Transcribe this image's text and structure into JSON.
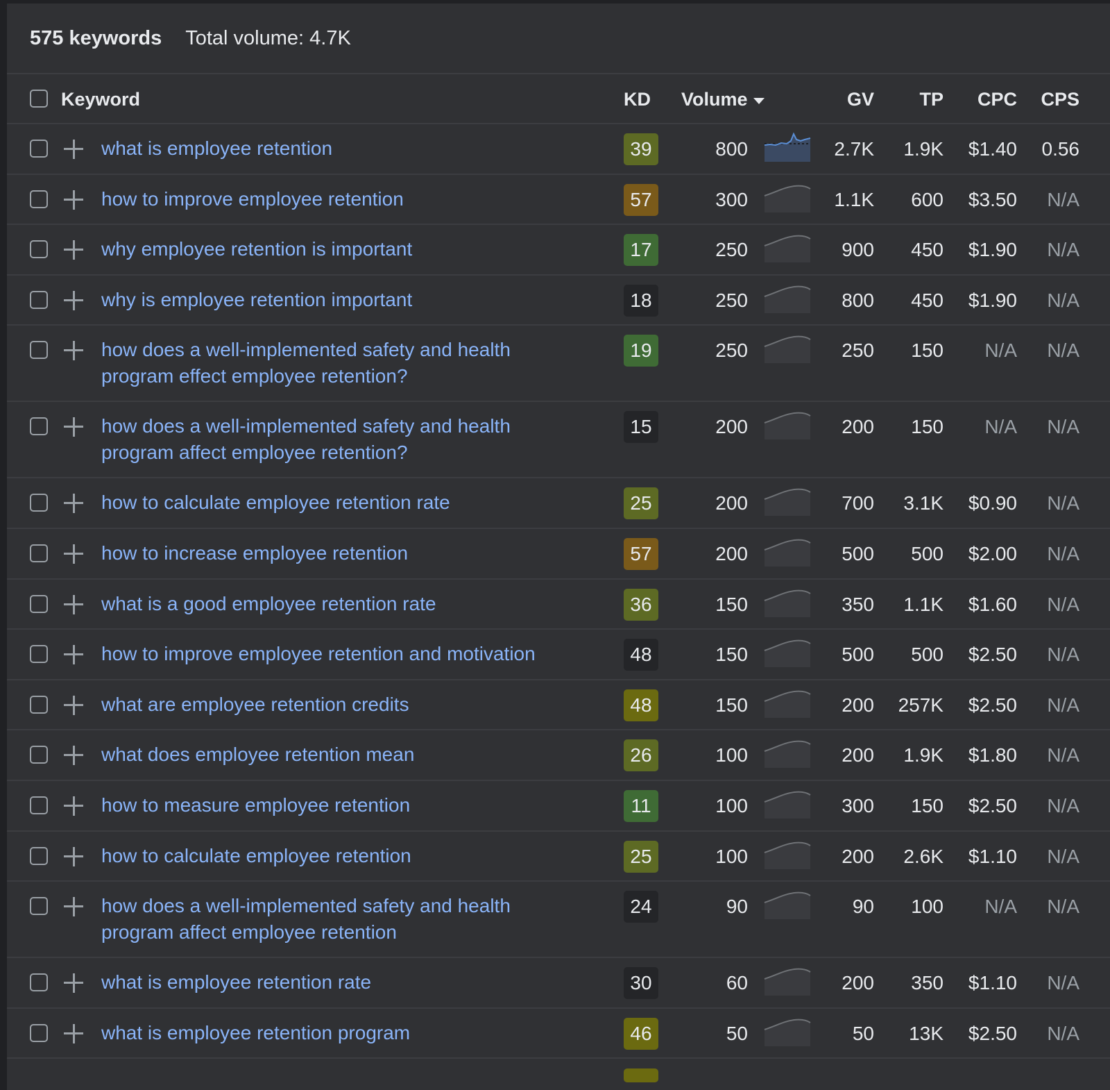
{
  "summary": {
    "keyword_count": "575 keywords",
    "total_volume": "Total volume: 4.7K"
  },
  "columns": {
    "keyword": "Keyword",
    "kd": "KD",
    "volume": "Volume",
    "gv": "GV",
    "tp": "TP",
    "cpc": "CPC",
    "cps": "CPS"
  },
  "sort": {
    "column": "Volume",
    "direction": "descending"
  },
  "kd_colors": {
    "green": "#3f6b35",
    "olive": "#5d6a24",
    "yellow": "#6b6a10",
    "orange": "#7a5a1a",
    "gray": "#242528"
  },
  "rows": [
    {
      "keyword": "what is employee retention",
      "kd": "39",
      "kd_color": "olive",
      "volume": "800",
      "trend": "spiky",
      "gv": "2.7K",
      "tp": "1.9K",
      "cpc": "$1.40",
      "cps": "0.56"
    },
    {
      "keyword": "how to improve employee retention",
      "kd": "57",
      "kd_color": "orange",
      "volume": "300",
      "trend": "flat",
      "gv": "1.1K",
      "tp": "600",
      "cpc": "$3.50",
      "cps": "N/A"
    },
    {
      "keyword": "why employee retention is important",
      "kd": "17",
      "kd_color": "green",
      "volume": "250",
      "trend": "flat",
      "gv": "900",
      "tp": "450",
      "cpc": "$1.90",
      "cps": "N/A"
    },
    {
      "keyword": "why is employee retention important",
      "kd": "18",
      "kd_color": "gray",
      "volume": "250",
      "trend": "flat",
      "gv": "800",
      "tp": "450",
      "cpc": "$1.90",
      "cps": "N/A"
    },
    {
      "keyword": "how does a well-implemented safety and health program effect employee retention?",
      "kd": "19",
      "kd_color": "green",
      "volume": "250",
      "trend": "flat",
      "gv": "250",
      "tp": "150",
      "cpc": "N/A",
      "cps": "N/A"
    },
    {
      "keyword": "how does a well-implemented safety and health program affect employee retention?",
      "kd": "15",
      "kd_color": "gray",
      "volume": "200",
      "trend": "flat",
      "gv": "200",
      "tp": "150",
      "cpc": "N/A",
      "cps": "N/A"
    },
    {
      "keyword": "how to calculate employee retention rate",
      "kd": "25",
      "kd_color": "olive",
      "volume": "200",
      "trend": "flat",
      "gv": "700",
      "tp": "3.1K",
      "cpc": "$0.90",
      "cps": "N/A"
    },
    {
      "keyword": "how to increase employee retention",
      "kd": "57",
      "kd_color": "orange",
      "volume": "200",
      "trend": "flat",
      "gv": "500",
      "tp": "500",
      "cpc": "$2.00",
      "cps": "N/A"
    },
    {
      "keyword": "what is a good employee retention rate",
      "kd": "36",
      "kd_color": "olive",
      "volume": "150",
      "trend": "flat",
      "gv": "350",
      "tp": "1.1K",
      "cpc": "$1.60",
      "cps": "N/A"
    },
    {
      "keyword": "how to improve employee retention and motivation",
      "kd": "48",
      "kd_color": "gray",
      "volume": "150",
      "trend": "flat",
      "gv": "500",
      "tp": "500",
      "cpc": "$2.50",
      "cps": "N/A"
    },
    {
      "keyword": "what are employee retention credits",
      "kd": "48",
      "kd_color": "yellow",
      "volume": "150",
      "trend": "flat",
      "gv": "200",
      "tp": "257K",
      "cpc": "$2.50",
      "cps": "N/A"
    },
    {
      "keyword": "what does employee retention mean",
      "kd": "26",
      "kd_color": "olive",
      "volume": "100",
      "trend": "flat",
      "gv": "200",
      "tp": "1.9K",
      "cpc": "$1.80",
      "cps": "N/A"
    },
    {
      "keyword": "how to measure employee retention",
      "kd": "11",
      "kd_color": "green",
      "volume": "100",
      "trend": "flat",
      "gv": "300",
      "tp": "150",
      "cpc": "$2.50",
      "cps": "N/A"
    },
    {
      "keyword": "how to calculate employee retention",
      "kd": "25",
      "kd_color": "olive",
      "volume": "100",
      "trend": "flat",
      "gv": "200",
      "tp": "2.6K",
      "cpc": "$1.10",
      "cps": "N/A"
    },
    {
      "keyword": "how does a well-implemented safety and health program affect employee retention",
      "kd": "24",
      "kd_color": "gray",
      "volume": "90",
      "trend": "flat",
      "gv": "90",
      "tp": "100",
      "cpc": "N/A",
      "cps": "N/A"
    },
    {
      "keyword": "what is employee retention rate",
      "kd": "30",
      "kd_color": "gray",
      "volume": "60",
      "trend": "flat",
      "gv": "200",
      "tp": "350",
      "cpc": "$1.10",
      "cps": "N/A"
    },
    {
      "keyword": "what is employee retention program",
      "kd": "46",
      "kd_color": "yellow",
      "volume": "50",
      "trend": "flat",
      "gv": "50",
      "tp": "13K",
      "cpc": "$2.50",
      "cps": "N/A"
    },
    {
      "keyword": "",
      "kd": "",
      "kd_color": "yellow",
      "volume": "",
      "trend": "flat",
      "gv": "",
      "tp": "",
      "cpc": "",
      "cps": ""
    }
  ]
}
